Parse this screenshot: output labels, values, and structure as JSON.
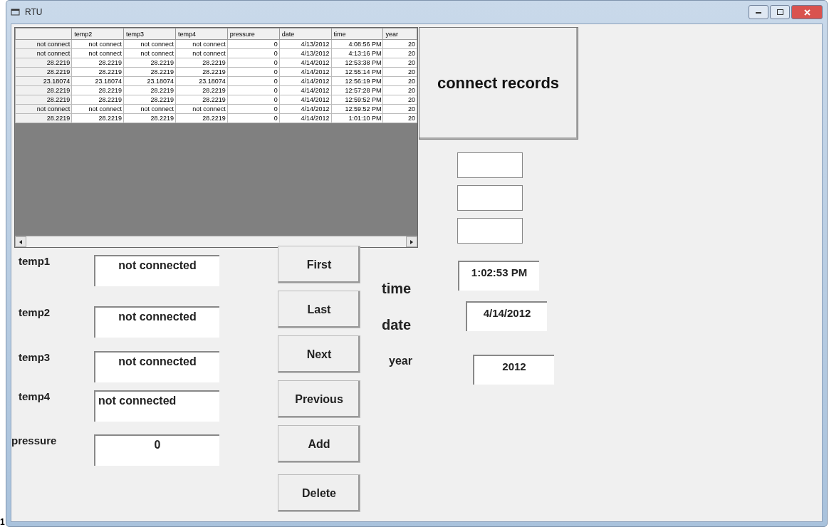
{
  "window": {
    "title": "RTU"
  },
  "table": {
    "columns": [
      "",
      "temp2",
      "temp3",
      "temp4",
      "pressure",
      "date",
      "time",
      "year"
    ],
    "rows": [
      {
        "cells": [
          "not connect",
          "not connect",
          "not connect",
          "not connect",
          "0",
          "4/13/2012",
          "4:08:56 PM",
          "20"
        ]
      },
      {
        "cells": [
          "not connect",
          "not connect",
          "not connect",
          "not connect",
          "0",
          "4/13/2012",
          "4:13:16 PM",
          "20"
        ]
      },
      {
        "cells": [
          "28.2219",
          "28.2219",
          "28.2219",
          "28.2219",
          "0",
          "4/14/2012",
          "12:53:38 PM",
          "20"
        ]
      },
      {
        "cells": [
          "28.2219",
          "28.2219",
          "28.2219",
          "28.2219",
          "0",
          "4/14/2012",
          "12:55:14 PM",
          "20"
        ]
      },
      {
        "cells": [
          "23.18074",
          "23.18074",
          "23.18074",
          "23.18074",
          "0",
          "4/14/2012",
          "12:56:19 PM",
          "20"
        ]
      },
      {
        "cells": [
          "28.2219",
          "28.2219",
          "28.2219",
          "28.2219",
          "0",
          "4/14/2012",
          "12:57:28 PM",
          "20"
        ]
      },
      {
        "cells": [
          "28.2219",
          "28.2219",
          "28.2219",
          "28.2219",
          "0",
          "4/14/2012",
          "12:59:52 PM",
          "20"
        ]
      },
      {
        "cells": [
          "not connect",
          "not connect",
          "not connect",
          "not connect",
          "0",
          "4/14/2012",
          "12:59:52 PM",
          "20"
        ]
      },
      {
        "cells": [
          "28.2219",
          "28.2219",
          "28.2219",
          "28.2219",
          "0",
          "4/14/2012",
          "1:01:10 PM",
          "20"
        ]
      }
    ]
  },
  "connect_button": "connect records",
  "fields": [
    {
      "label": "temp1",
      "value": "not connected",
      "left_aligned": false
    },
    {
      "label": "temp2",
      "value": "not connected",
      "left_aligned": false
    },
    {
      "label": "temp3",
      "value": "not connected",
      "left_aligned": false
    },
    {
      "label": "temp4",
      "value": "not connected",
      "left_aligned": true
    },
    {
      "label": "pressure",
      "value": "0",
      "left_aligned": false
    }
  ],
  "buttons": [
    "First",
    "Last",
    "Next",
    "Previous",
    "Add",
    "Delete"
  ],
  "clock": [
    {
      "label": "time",
      "value": "1:02:53 PM"
    },
    {
      "label": "date",
      "value": "4/14/2012"
    },
    {
      "label": "year",
      "value": "2012"
    }
  ],
  "stray_mark": "1"
}
